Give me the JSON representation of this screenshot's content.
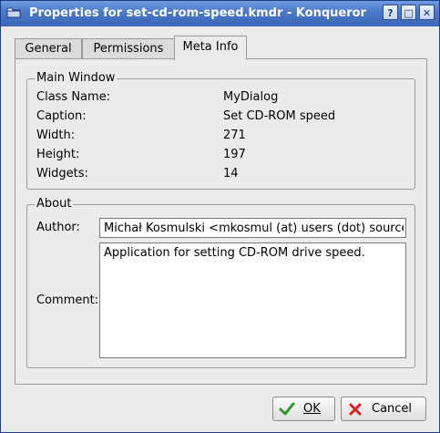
{
  "window": {
    "title": "Properties for set-cd-rom-speed.kmdr - Konqueror",
    "help_button": "?",
    "maximize_button": "□",
    "close_button": "✕"
  },
  "tabs": [
    {
      "label": "General",
      "active": false
    },
    {
      "label": "Permissions",
      "active": false
    },
    {
      "label": "Meta Info",
      "active": true
    }
  ],
  "main_window": {
    "legend": "Main Window",
    "rows": [
      {
        "label": "Class Name:",
        "value": "MyDialog"
      },
      {
        "label": "Caption:",
        "value": "Set CD-ROM speed"
      },
      {
        "label": "Width:",
        "value": "271"
      },
      {
        "label": "Height:",
        "value": "197"
      },
      {
        "label": "Widgets:",
        "value": "14"
      }
    ]
  },
  "about": {
    "legend": "About",
    "author_label": "Author:",
    "author_value": "Michał Kosmulski <mkosmul (at) users (dot) sourcefo",
    "comment_label": "Comment:",
    "comment_value": "Application for setting CD-ROM drive speed."
  },
  "buttons": {
    "ok_label": "OK",
    "cancel_label": "Cancel"
  },
  "colors": {
    "titlebar": "#4a78c8",
    "ok_icon": "#2e9b2e",
    "cancel_icon": "#d42222"
  }
}
